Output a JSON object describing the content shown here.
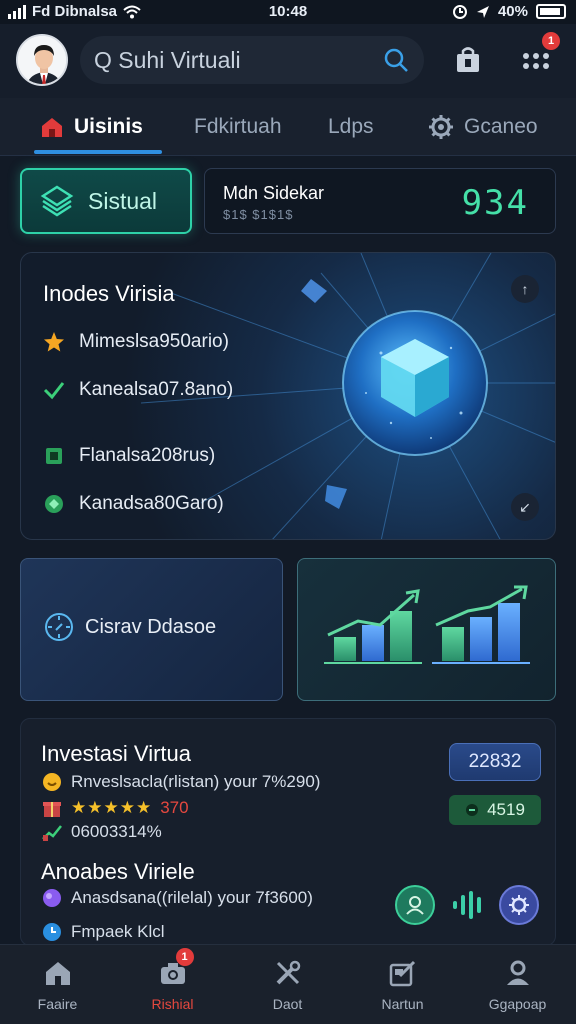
{
  "status_bar": {
    "carrier": "Fd Dibnalsa",
    "time": "10:48",
    "battery": "40%"
  },
  "header": {
    "search_text": "Q Suhi Virtuali",
    "notification_count": "1"
  },
  "tabs": [
    {
      "label": "Uisinis",
      "icon": "home-icon",
      "active": true
    },
    {
      "label": "Fdkirtuah"
    },
    {
      "label": "Ldps"
    },
    {
      "label": "Gcaneo",
      "icon": "gear-icon"
    }
  ],
  "stats": {
    "button_label": "Sistual",
    "card_title": "Mdn Sidekar",
    "card_subtitle": "$1$ $1$1$",
    "card_value": "934"
  },
  "hero": {
    "title": "Inodes Virisia",
    "items": [
      {
        "label": "Mimeslsa950ario)",
        "icon": "star-icon"
      },
      {
        "label": "Kanealsa07.8ano)",
        "icon": "check-icon"
      },
      {
        "label": "Flanalsa208rus)",
        "icon": "chip-icon"
      },
      {
        "label": "Kanadsa80Garo)",
        "icon": "gem-icon"
      }
    ]
  },
  "middle": {
    "card1_label": "Cisrav Ddasoe"
  },
  "panel": {
    "title1": "Investasi Virtua",
    "row1": "Rnveslsacla(rlistan) your 7%290)",
    "rating_stars": "★★★★★",
    "rating_value": "370",
    "row3": "06003314%",
    "title2": "Anoabes Viriele",
    "row4": "Anasdsana((rilelal) your 7f3600)",
    "row5": "Fmpaek Klcl",
    "pill1": "22832",
    "pill2": "4519"
  },
  "nav": [
    {
      "label": "Faaire",
      "icon": "home-icon"
    },
    {
      "label": "Rishial",
      "icon": "camera-icon",
      "active": true,
      "badge": "1"
    },
    {
      "label": "Daot",
      "icon": "tools-icon"
    },
    {
      "label": "Nartun",
      "icon": "edit-icon"
    },
    {
      "label": "Ggapoap",
      "icon": "profile-icon"
    }
  ],
  "colors": {
    "accent_green": "#45e0a8",
    "accent_blue": "#2f8fe0",
    "nav_active": "#e5483f"
  }
}
